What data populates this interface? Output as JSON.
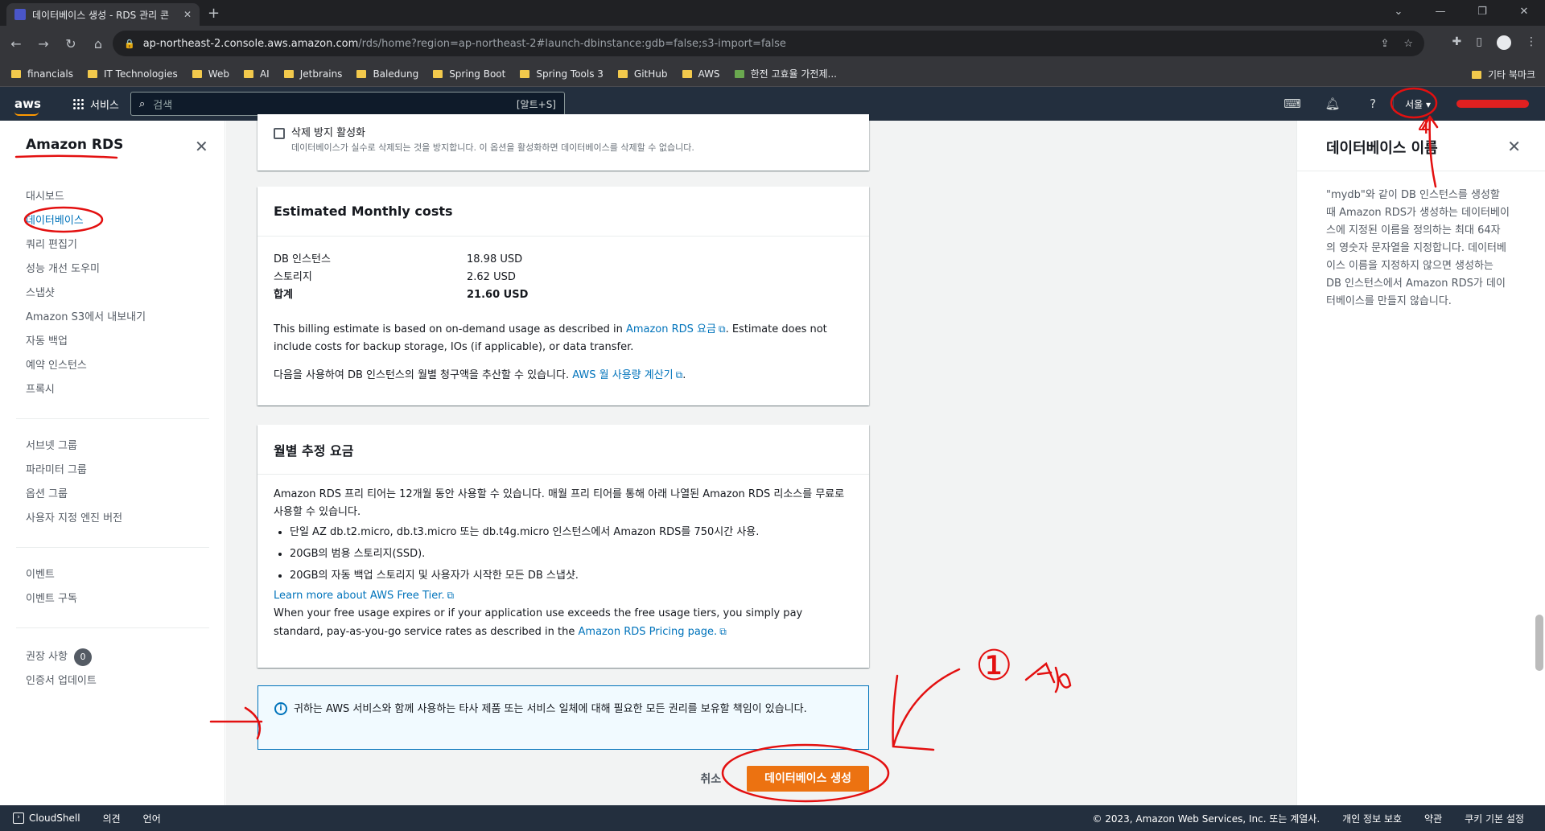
{
  "browser": {
    "tab_title": "데이터베이스 생성 - RDS 관리 콘",
    "url_host": "ap-northeast-2.console.aws.amazon.com",
    "url_path": "/rds/home?region=ap-northeast-2#launch-dbinstance:gdb=false;s3-import=false",
    "bookmarks": [
      "financials",
      "IT Technologies",
      "Web",
      "AI",
      "Jetbrains",
      "Baledung",
      "Spring Boot",
      "Spring Tools 3",
      "GitHub",
      "AWS",
      "한전 고효율 가전제..."
    ],
    "bookmarks_other": "기타 북마크"
  },
  "aws_header": {
    "logo": "aws",
    "services_label": "서비스",
    "search_placeholder": "검색",
    "search_shortcut": "[알트+S]",
    "region": "서울 ▾"
  },
  "sidenav": {
    "title": "Amazon RDS",
    "group1": [
      "대시보드",
      "데이터베이스",
      "쿼리 편집기",
      "성능 개선 도우미",
      "스냅샷",
      "Amazon S3에서 내보내기",
      "자동 백업",
      "예약 인스턴스",
      "프록시"
    ],
    "group2": [
      "서브넷 그룹",
      "파라미터 그룹",
      "옵션 그룹",
      "사용자 지정 엔진 버전"
    ],
    "group3": [
      "이벤트",
      "이벤트 구독"
    ],
    "recommendations": "권장 사항",
    "recommendations_count": "0",
    "cert_update": "인증서 업데이트"
  },
  "deletion_protection": {
    "label": "삭제 방지 활성화",
    "desc": "데이터베이스가 실수로 삭제되는 것을 방지합니다. 이 옵션을 활성화하면 데이터베이스를 삭제할 수 없습니다."
  },
  "estimated_costs": {
    "title": "Estimated Monthly costs",
    "rows": [
      {
        "label": "DB 인스턴스",
        "value": "18.98 USD"
      },
      {
        "label": "스토리지",
        "value": "2.62 USD"
      },
      {
        "label": "합계",
        "value": "21.60 USD"
      }
    ],
    "billing_text_1": "This billing estimate is based on on-demand usage as described in",
    "billing_link": "Amazon RDS 요금",
    "billing_text_2": ". Estimate does not include costs for backup storage, IOs (if applicable), or data transfer.",
    "calc_text": "다음을 사용하여 DB 인스턴스의 월별 청구액을 추산할 수 있습니다.",
    "calc_link": "AWS 월 사용량 계산기"
  },
  "free_tier": {
    "title": "월별 추정 요금",
    "intro": "Amazon RDS 프리 티어는 12개월 동안 사용할 수 있습니다. 매월 프리 티어를 통해 아래 나열된 Amazon RDS 리소스를 무료로 사용할 수 있습니다.",
    "bullets": [
      "단일 AZ db.t2.micro, db.t3.micro 또는 db.t4g.micro 인스턴스에서 Amazon RDS를 750시간 사용.",
      "20GB의 범용 스토리지(SSD).",
      "20GB의 자동 백업 스토리지 및 사용자가 시작한 모든 DB 스냅샷."
    ],
    "learn_more": "Learn more about AWS Free Tier.",
    "outro": "When your free usage expires or if your application use exceeds the free usage tiers, you simply pay standard, pay-as-you-go service rates as described in the",
    "pricing_link": "Amazon RDS Pricing page."
  },
  "info_alert": "귀하는 AWS 서비스와 함께 사용하는 타사 제품 또는 서비스 일체에 대해 필요한 모든 권리를 보유할 책임이 있습니다.",
  "actions": {
    "cancel": "취소",
    "create": "데이터베이스 생성"
  },
  "help_panel": {
    "title": "데이터베이스 이름",
    "body": "\"mydb\"와 같이 DB 인스턴스를 생성할 때 Amazon RDS가 생성하는 데이터베이스에 지정된 이름을 정의하는 최대 64자의 영숫자 문자열을 지정합니다. 데이터베이스 이름을 지정하지 않으면 생성하는 DB 인스턴스에서 Amazon RDS가 데이터베이스를 만들지 않습니다."
  },
  "footer": {
    "cloudshell": "CloudShell",
    "feedback": "의견",
    "language": "언어",
    "copyright": "© 2023, Amazon Web Services, Inc. 또는 계열사.",
    "privacy": "개인 정보 보호",
    "terms": "약관",
    "cookies": "쿠키 기본 설정"
  },
  "annotations": {
    "label_1": "①",
    "label_2": "4"
  }
}
